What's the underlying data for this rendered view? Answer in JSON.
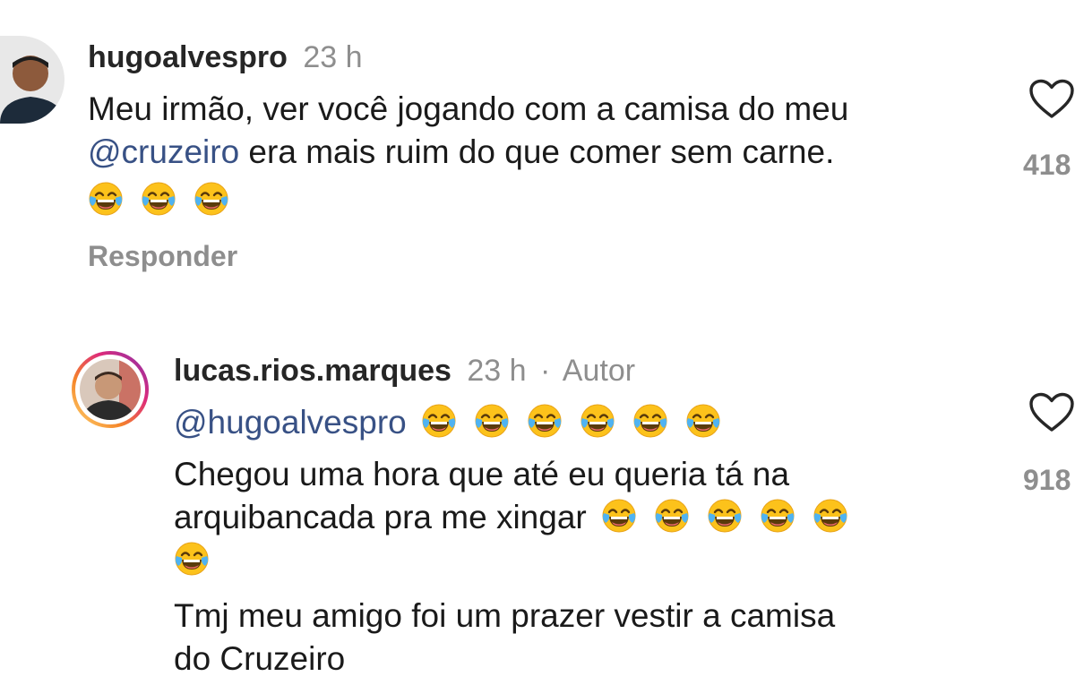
{
  "comments": [
    {
      "username": "hugoalvespro",
      "time": "23 h",
      "text_line1": "Meu irmão, ver você jogando com a camisa do meu",
      "mention": "@cruzeiro",
      "text_line2_rest": " era mais ruim do que comer sem carne.",
      "emoji": "face-with-tears-of-joy",
      "emoji_count": 3,
      "reply_label": "Responder",
      "likes": "418"
    },
    {
      "username": "lucas.rios.marques",
      "time": "23 h",
      "separator": "·",
      "author_badge": "Autor",
      "mention": "@hugoalvespro",
      "mention_emoji_count": 6,
      "text_line1": "Chegou uma hora que até eu queria tá na",
      "text_line2": "arquibancada pra me xingar",
      "line2_emoji_count": 5,
      "line3_emoji_count": 1,
      "text_line4": "Tmj meu amigo foi um prazer vestir a camisa",
      "text_line5": "do Cruzeiro",
      "likes": "918"
    }
  ],
  "colors": {
    "mention": "#385185",
    "meta": "#8e8e8e",
    "story_ring_start": "#f58529",
    "story_ring_end": "#dd2a7b"
  },
  "icons": {
    "like": "heart-outline-icon",
    "emoji": "face-with-tears-of-joy"
  }
}
